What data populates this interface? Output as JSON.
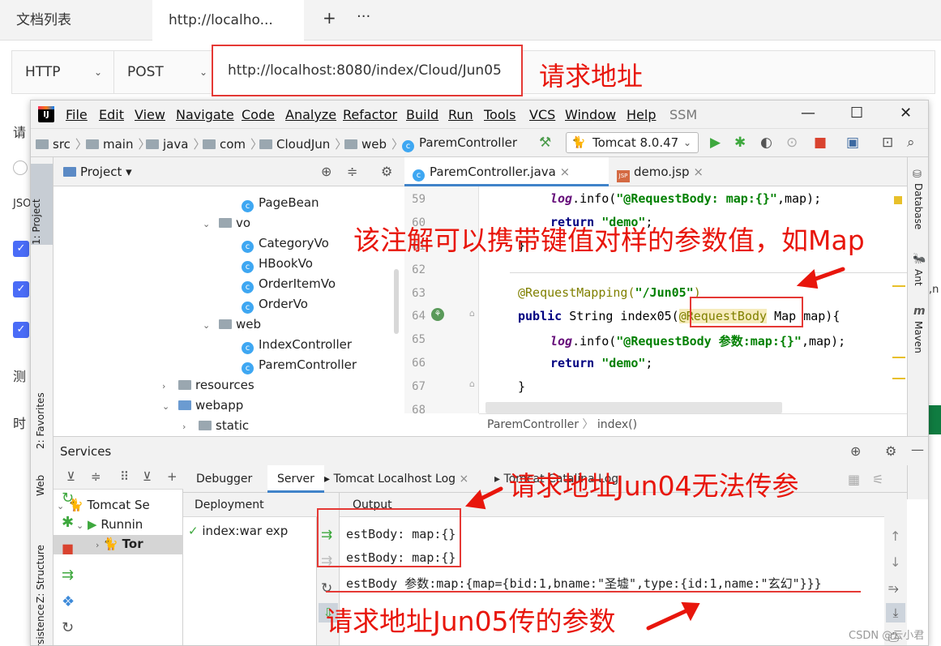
{
  "bg": {
    "tabs": [
      "文档列表",
      "http://localho..."
    ],
    "add_tab": "+",
    "more": "···",
    "protocol": "HTTP",
    "method": "POST",
    "url": "http://localhost:8080/index/Cloud/Jun05",
    "left_labels": [
      "请",
      "JSO",
      "测",
      "时"
    ],
    "right_text": ",n"
  },
  "annotations": {
    "url": "请求地址",
    "map": "该注解可以携带键值对样的参数值，如Map",
    "jun04": "请求地址Jun04无法传参",
    "jun05": "请求地址Jun05传的参数",
    "color": "#e8160c"
  },
  "ide": {
    "logo": "IJ",
    "menu": [
      "File",
      "Edit",
      "View",
      "Navigate",
      "Code",
      "Analyze",
      "Refactor",
      "Build",
      "Run",
      "Tools",
      "VCS",
      "Window",
      "Help"
    ],
    "project_label": "SSM",
    "window_buttons": [
      "—",
      "☐",
      "✕"
    ],
    "breadcrumb": [
      "src",
      "main",
      "java",
      "com",
      "CloudJun",
      "web",
      "ParemController"
    ],
    "run_config": "Tomcat 8.0.47",
    "left_tabs": [
      "1: Project",
      "2: Favorites",
      "Web",
      "Z: Structure",
      "Persistence"
    ],
    "right_tabs": [
      "Database",
      "Ant",
      "Maven"
    ],
    "project_panel_title": "Project",
    "tree": [
      {
        "label": "PageBean",
        "type": "class"
      },
      {
        "label": "vo",
        "type": "folder",
        "open": true
      },
      {
        "label": "CategoryVo",
        "type": "class"
      },
      {
        "label": "HBookVo",
        "type": "class"
      },
      {
        "label": "OrderItemVo",
        "type": "class"
      },
      {
        "label": "OrderVo",
        "type": "class"
      },
      {
        "label": "web",
        "type": "folder",
        "open": true
      },
      {
        "label": "IndexController",
        "type": "class"
      },
      {
        "label": "ParemController",
        "type": "class"
      },
      {
        "label": "resources",
        "type": "folder",
        "open": false
      },
      {
        "label": "webapp",
        "type": "folder",
        "open": true
      },
      {
        "label": "static",
        "type": "folder",
        "open": false
      }
    ],
    "editor_tabs": [
      "ParemController.java",
      "demo.jsp"
    ],
    "line_numbers": [
      "59",
      "60",
      "61",
      "62",
      "63",
      "64",
      "65",
      "66",
      "67",
      "68"
    ],
    "code": {
      "l59a": "log",
      "l59b": ".info(",
      "l59c": "\"@RequestBody: map:{}\"",
      "l59d": ",map);",
      "l60a": "return ",
      "l60b": "\"demo\"",
      "l60c": ";",
      "l61": "}",
      "l63a": "@RequestMapping(",
      "l63b": "\"/Jun05\"",
      "l63c": ")",
      "l64a": "public ",
      "l64b": "String index05(",
      "l64c": "@RequestBody",
      "l64d": " Map map){",
      "l65a": "log",
      "l65b": ".info(",
      "l65c": "\"@RequestBody 参数:map:{}\"",
      "l65d": ",map);",
      "l66a": "return ",
      "l66b": "\"demo\"",
      "l66c": ";",
      "l67": "}"
    },
    "editor_breadcrumb": [
      "ParemController",
      "index()"
    ],
    "services_title": "Services",
    "svc_tree": [
      "Tomcat Se",
      "Runnin",
      "Tor"
    ],
    "svc_tabs": [
      "Debugger",
      "Server",
      "Tomcat Localhost Log",
      "Tomcat Catalina Log"
    ],
    "deployment_header": "Deployment",
    "deployment_item": "index:war exp",
    "output_header": "Output",
    "output_lines": [
      "estBody: map:{}",
      "estBody: map:{}",
      "estBody 参数:map:{map={bid:1,bname:\"圣墟\",type:{id:1,name:\"玄幻\"}}}"
    ]
  },
  "watermark": "CSDN @云小君"
}
